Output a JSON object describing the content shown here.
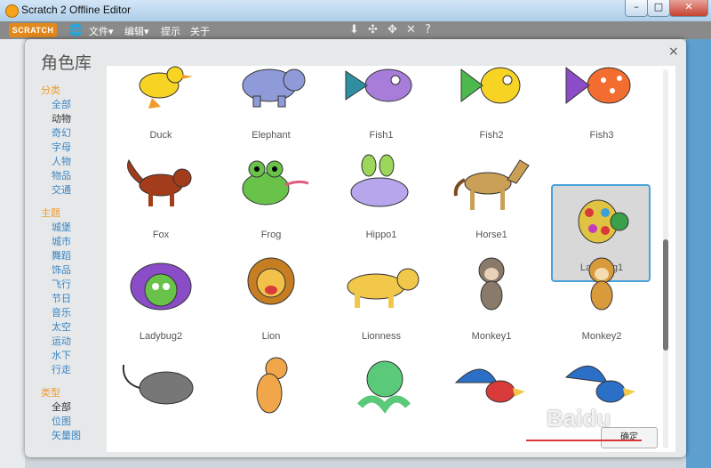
{
  "window": {
    "title": "Scratch 2 Offline Editor",
    "min": "–",
    "max": "□",
    "close": "✕"
  },
  "menubar": {
    "logo": "SCRATCH",
    "items": [
      "文件▾",
      "编辑▾",
      "提示",
      "关于"
    ]
  },
  "dialog": {
    "title": "角色库",
    "close": "×",
    "categories": {
      "group1_title": "分类",
      "group1": [
        "全部",
        "动物",
        "奇幻",
        "字母",
        "人物",
        "物品",
        "交通"
      ],
      "group2_title": "主题",
      "group2": [
        "城堡",
        "城市",
        "舞蹈",
        "饰品",
        "飞行",
        "节日",
        "音乐",
        "太空",
        "运动",
        "水下",
        "行走"
      ],
      "group3_title": "类型",
      "group3": [
        "全部",
        "位图",
        "矢量图"
      ]
    },
    "sprites": [
      {
        "name": "Duck"
      },
      {
        "name": "Elephant"
      },
      {
        "name": "Fish1"
      },
      {
        "name": "Fish2"
      },
      {
        "name": "Fish3"
      },
      {
        "name": "Fox"
      },
      {
        "name": "Frog"
      },
      {
        "name": "Hippo1"
      },
      {
        "name": "Horse1"
      },
      {
        "name": "Ladybug1"
      },
      {
        "name": "Ladybug2"
      },
      {
        "name": "Lion"
      },
      {
        "name": "Lionness"
      },
      {
        "name": "Monkey1"
      },
      {
        "name": "Monkey2"
      },
      {
        "name": ""
      },
      {
        "name": ""
      },
      {
        "name": ""
      },
      {
        "name": ""
      },
      {
        "name": ""
      }
    ],
    "selected": "Ladybug1",
    "ok_label": "确定"
  },
  "watermark": "Baidu",
  "colors": {
    "accent": "#4aa3d9",
    "category_title": "#f29b2b",
    "category_link": "#3b86c4"
  }
}
